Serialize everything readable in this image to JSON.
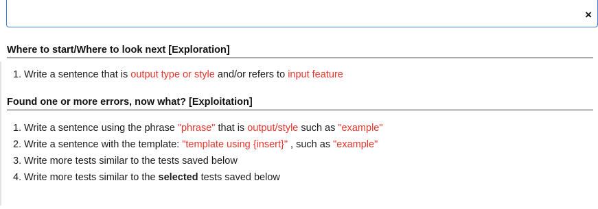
{
  "close_icon": "×",
  "exploration": {
    "heading": "Where to start/Where to look next [Exploration]",
    "items": [
      {
        "num": "1.",
        "t1": "Write a sentence that is ",
        "h1": "output type or style",
        "t2": " and/or refers to ",
        "h2": "input feature"
      }
    ]
  },
  "exploitation": {
    "heading": "Found one or more errors, now what? [Exploitation]",
    "items": [
      {
        "num": "1.",
        "t1": "Write a sentence using the phrase ",
        "h1": "\"phrase\"",
        "t2": " that is ",
        "h2": "output/style",
        "t3": " such as ",
        "h3": "\"example\""
      },
      {
        "num": "2.",
        "t1": "Write a sentence with the template: ",
        "h1": "\"template using {insert}\"",
        "t2": " , such as ",
        "h2": "\"example\""
      },
      {
        "num": "3.",
        "t1": "Write more tests similar to the tests saved below"
      },
      {
        "num": "4.",
        "t1": "Write more tests similar to the ",
        "b1": "selected",
        "t2": " tests saved below"
      }
    ]
  },
  "colors": {
    "highlight": "#e8332a",
    "input_border": "#3b7dd8"
  }
}
